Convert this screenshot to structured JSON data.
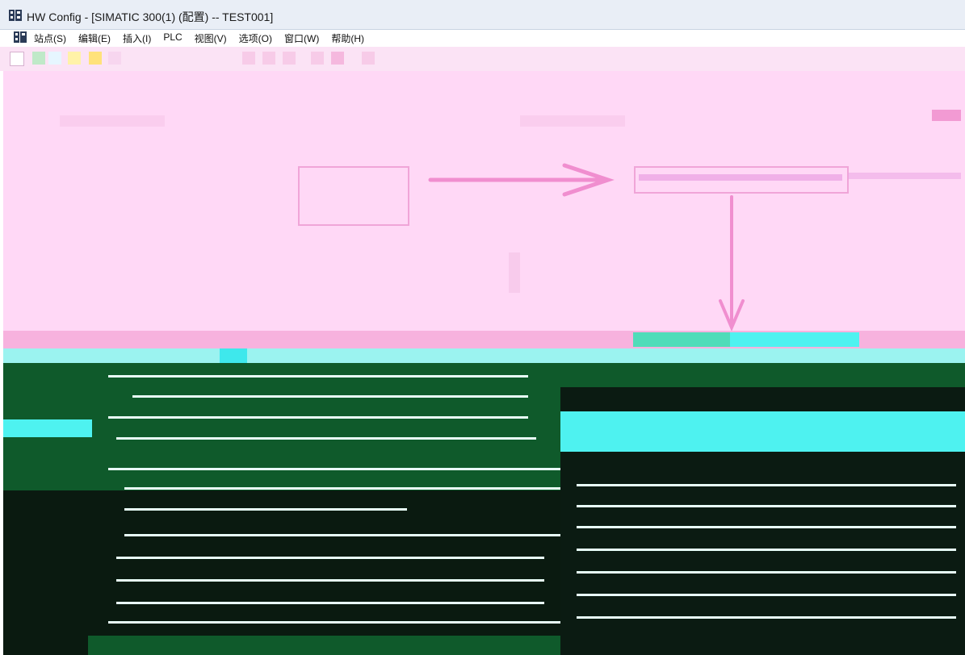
{
  "window": {
    "title": "HW Config - [SIMATIC 300(1) (配置) -- TEST001]"
  },
  "menu": {
    "items": [
      {
        "label": "站点(S)"
      },
      {
        "label": "编辑(E)"
      },
      {
        "label": "插入(I)"
      },
      {
        "label": "PLC"
      },
      {
        "label": "视图(V)"
      },
      {
        "label": "选项(O)"
      },
      {
        "label": "窗口(W)"
      },
      {
        "label": "帮助(H)"
      }
    ]
  },
  "colors": {
    "title_bg": "#e9eef6",
    "toolbar_bg": "#fbe3f5",
    "station_bg": "#ffd8f6",
    "annotation_pink": "#f0a5d8",
    "lower_pane_bg": "#0a1a10",
    "accent_cyan": "#4ef2f0"
  },
  "icons": {
    "app": "hw-config-app-icon",
    "document": "station-window-icon"
  }
}
